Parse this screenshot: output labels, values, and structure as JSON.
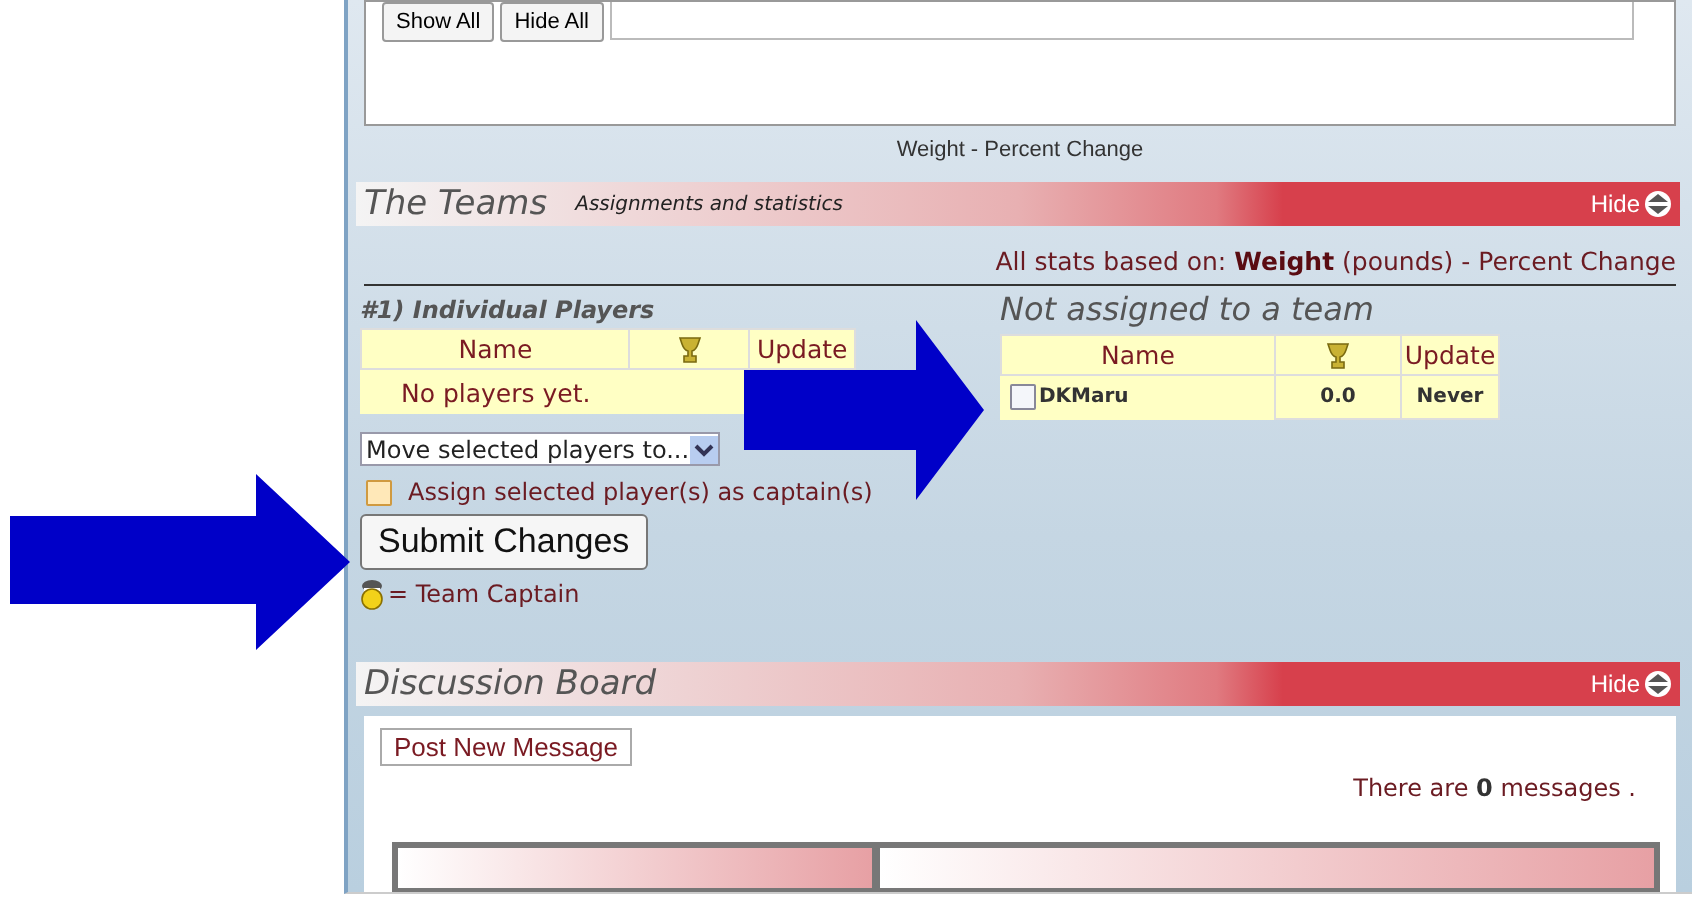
{
  "chart_panel": {
    "buttons": [
      "Show All",
      "Hide All"
    ],
    "caption": "Weight - Percent Change"
  },
  "teams_section": {
    "title": "The Teams",
    "subtitle": "Assignments and statistics",
    "toggle": "Hide",
    "stats_note": "All stats based on: **Weight** (pounds) - Percent Change",
    "team": {
      "heading": "#1) Individual Players",
      "columns": [
        "Name",
        "Update"
      ],
      "empty_text": "No players yet."
    },
    "unassigned": {
      "heading": "Not assigned to a team",
      "columns": [
        "Name",
        "Update"
      ],
      "rows": [
        {
          "name": "DKMaru",
          "score": "0.0",
          "update": "Never",
          "checked": false
        }
      ]
    },
    "move_select": {
      "value": "Move selected players to..."
    },
    "captain_option": {
      "label": "Assign selected player(s) as captain(s)",
      "checked": false
    },
    "submit": "Submit Changes",
    "legend": "= Team Captain"
  },
  "discussion": {
    "title": "Discussion Board",
    "toggle": "Hide",
    "post_button": "Post New Message",
    "count_note": "There are **0** messages ."
  }
}
